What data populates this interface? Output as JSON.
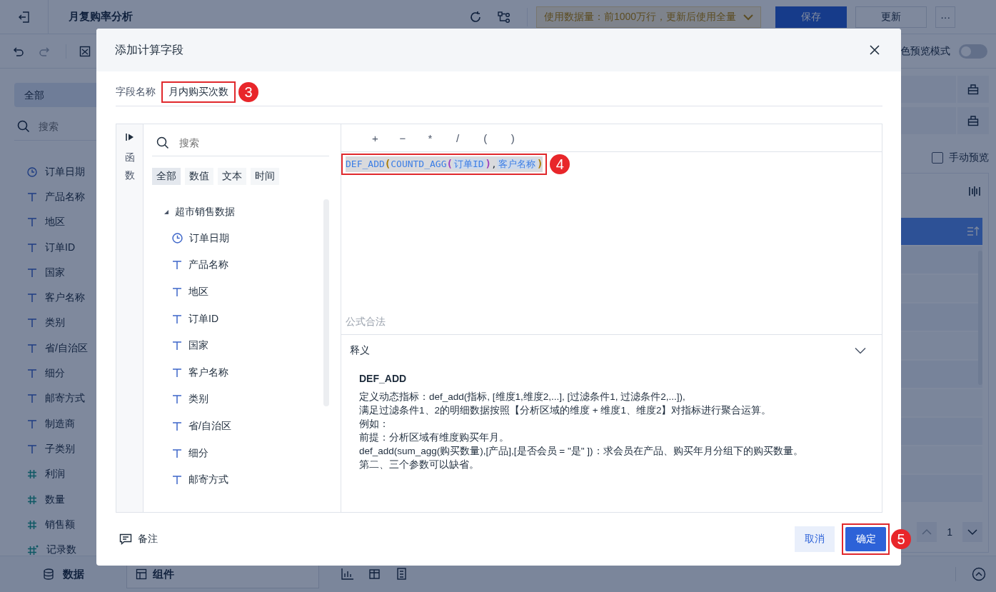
{
  "app": {
    "title": "月复购率分析",
    "data_notice": "使用数据量：前1000万行，更新后使用全量",
    "buttons": [
      {
        "label": "保存",
        "kind": "primary"
      },
      {
        "label": "更新",
        "kind": "secondary"
      },
      {
        "label": "···",
        "kind": "more"
      }
    ]
  },
  "toolbar": {
    "preview_mode": {
      "label": "色预览模式",
      "on": false
    }
  },
  "sidebar": {
    "tabs": [
      {
        "label": "全部",
        "selected": true
      }
    ],
    "search": {
      "placeholder": "搜索"
    },
    "fields": [
      {
        "name": "订单日期",
        "kind": "date"
      },
      {
        "name": "产品名称",
        "kind": "text"
      },
      {
        "name": "地区",
        "kind": "text"
      },
      {
        "name": "订单ID",
        "kind": "text"
      },
      {
        "name": "国家",
        "kind": "text"
      },
      {
        "name": "客户名称",
        "kind": "text"
      },
      {
        "name": "类别",
        "kind": "text"
      },
      {
        "name": "省/自治区",
        "kind": "text"
      },
      {
        "name": "细分",
        "kind": "text"
      },
      {
        "name": "邮寄方式",
        "kind": "text"
      },
      {
        "name": "制造商",
        "kind": "text"
      },
      {
        "name": "子类别",
        "kind": "text"
      },
      {
        "name": "利润",
        "kind": "number"
      },
      {
        "name": "数量",
        "kind": "number"
      },
      {
        "name": "销售额",
        "kind": "number"
      },
      {
        "name": "记录数",
        "kind": "calc"
      }
    ]
  },
  "right_panel": {
    "manual_preview": {
      "label": "手动预览",
      "checked": false
    },
    "page": "1"
  },
  "bottom_bar": {
    "tabs": [
      {
        "label": "数据",
        "selected": true
      },
      {
        "label": "组件",
        "selected": false
      }
    ]
  },
  "dialog": {
    "title": "添加计算字段",
    "field_name": {
      "label": "字段名称",
      "value": "月内购买次数",
      "annotation": "3"
    },
    "side_tab": "函数",
    "field_search": {
      "placeholder": "搜索"
    },
    "filter_tabs": [
      {
        "label": "全部",
        "selected": true
      },
      {
        "label": "数值",
        "selected": false
      },
      {
        "label": "文本",
        "selected": false
      },
      {
        "label": "时间",
        "selected": false
      }
    ],
    "tree": {
      "name": "超市销售数据",
      "expanded": true,
      "children": [
        {
          "name": "订单日期",
          "kind": "date"
        },
        {
          "name": "产品名称",
          "kind": "text"
        },
        {
          "name": "地区",
          "kind": "text"
        },
        {
          "name": "订单ID",
          "kind": "text"
        },
        {
          "name": "国家",
          "kind": "text"
        },
        {
          "name": "客户名称",
          "kind": "text"
        },
        {
          "name": "类别",
          "kind": "text"
        },
        {
          "name": "省/自治区",
          "kind": "text"
        },
        {
          "name": "细分",
          "kind": "text"
        },
        {
          "name": "邮寄方式",
          "kind": "text"
        }
      ]
    },
    "operators": [
      "+",
      "−",
      "*",
      "/",
      "(",
      ")"
    ],
    "formula": {
      "annotation": "4",
      "tokens": [
        {
          "text": "DEF_ADD",
          "kind": "function"
        },
        {
          "text": "(",
          "kind": "bracket",
          "color": "#a87a00"
        },
        {
          "text": "COUNTD_AGG",
          "kind": "function"
        },
        {
          "text": "(",
          "kind": "bracket",
          "color": "#9b3fc0"
        },
        {
          "text": "订单ID",
          "kind": "field"
        },
        {
          "text": ")",
          "kind": "bracket",
          "color": "#9b3fc0"
        },
        {
          "text": ",",
          "kind": "separator"
        },
        {
          "text": "客户名称",
          "kind": "field"
        },
        {
          "text": ")",
          "kind": "bracket",
          "color": "#a87a00"
        }
      ]
    },
    "status": "公式合法",
    "explanation": {
      "heading": "释义",
      "expanded": true,
      "title": "DEF_ADD",
      "lines": [
        "定义动态指标：def_add(指标, [维度1,维度2,...], [过滤条件1, 过滤条件2,...]),",
        "满足过滤条件1、2的明细数据按照【分析区域的维度 + 维度1、维度2】对指标进行聚合运算。",
        "例如：",
        "前提：分析区域有维度购买年月。",
        "def_add(sum_agg(购买数量),[产品],[是否会员 = \"是\" ])：求会员在产品、购买年月分组下的购买数量。",
        "第二、三个参数可以缺省。"
      ]
    },
    "footer": {
      "note": "备注",
      "cancel": "取消",
      "confirm": "确定",
      "confirm_annotation": "5"
    }
  }
}
